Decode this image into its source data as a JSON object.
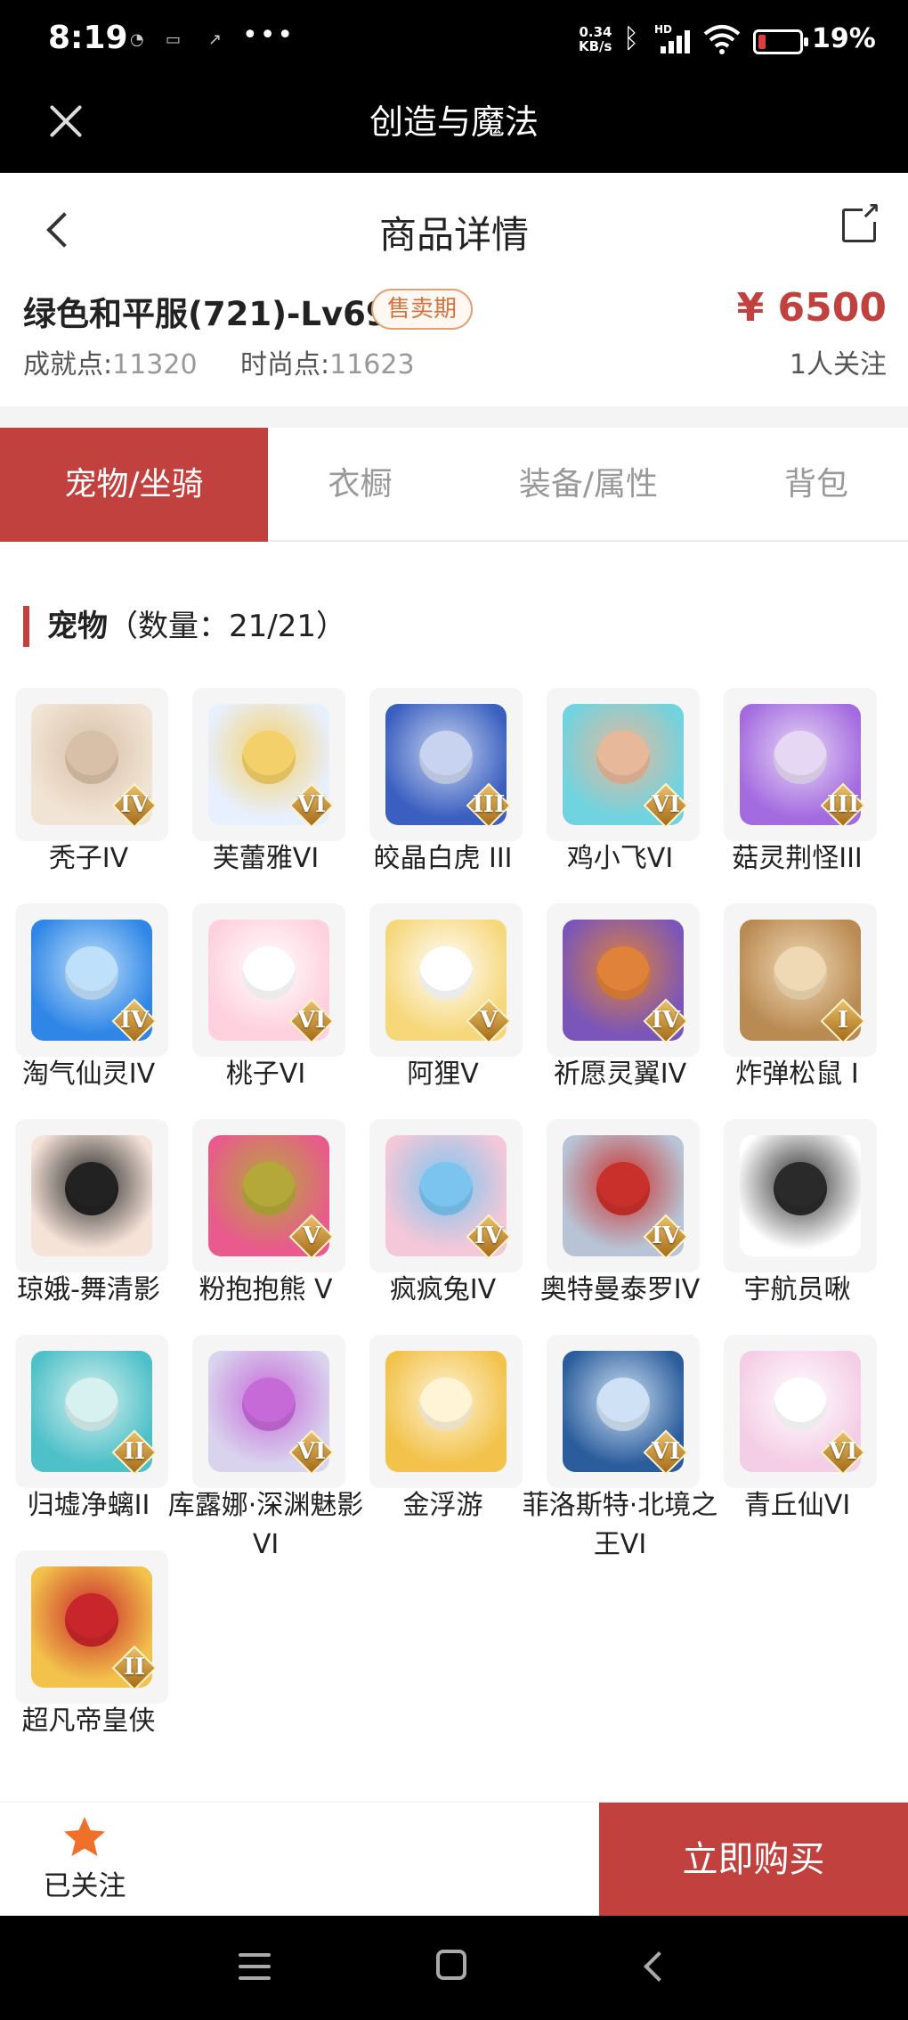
{
  "status_bar": {
    "time": "8:19",
    "net_speed_value": "0.34",
    "net_speed_unit": "KB/s",
    "signal_tag": "HD",
    "battery_pct": "19%",
    "battery_level": 0.19
  },
  "app_bar": {
    "title": "创造与魔法"
  },
  "page": {
    "title": "商品详情"
  },
  "product": {
    "name": "绿色和平服(721)-Lv69",
    "badge": "售卖期",
    "price": "¥ 6500",
    "achievement_label": "成就点:",
    "achievement_value": "11320",
    "fashion_label": "时尚点:",
    "fashion_value": "11623",
    "followers": "1人关注"
  },
  "tabs": [
    {
      "label": "宠物/坐骑",
      "active": true
    },
    {
      "label": "衣橱",
      "active": false
    },
    {
      "label": "装备/属性",
      "active": false
    },
    {
      "label": "背包",
      "active": false
    }
  ],
  "section": {
    "title": "宠物",
    "count_text": "（数量：21/21）"
  },
  "pets": [
    {
      "name": "秃子IV",
      "rank": "IV",
      "icon": "bald-kid-pet",
      "colors": [
        "#f1e4d4",
        "#d8c0a8"
      ]
    },
    {
      "name": "芙蕾雅VI",
      "rank": "VI",
      "icon": "winged-girl-pet",
      "colors": [
        "#e8f0ff",
        "#f4d06a"
      ]
    },
    {
      "name": "皎晶白虎 III",
      "rank": "III",
      "icon": "white-tiger-pet",
      "colors": [
        "#3a5fc0",
        "#c8d4ef"
      ]
    },
    {
      "name": "鸡小飞VI",
      "rank": "VI",
      "icon": "chick-pet",
      "colors": [
        "#6fd3e0",
        "#e8b89a"
      ]
    },
    {
      "name": "菇灵荆怪III",
      "rank": "III",
      "icon": "mushroom-elf-pet",
      "colors": [
        "#a46be0",
        "#e6d7f5"
      ]
    },
    {
      "name": "淘气仙灵IV",
      "rank": "IV",
      "icon": "blue-dog-pet",
      "colors": [
        "#2f86e6",
        "#bfe0fb"
      ]
    },
    {
      "name": "桃子VI",
      "rank": "VI",
      "icon": "pink-bunny-pet",
      "colors": [
        "#ffd0de",
        "#ffffff"
      ]
    },
    {
      "name": "阿狸V",
      "rank": "V",
      "icon": "lion-cat-pet",
      "colors": [
        "#f6d77a",
        "#ffffff"
      ]
    },
    {
      "name": "祈愿灵翼IV",
      "rank": "IV",
      "icon": "eagle-pet",
      "colors": [
        "#7b56b8",
        "#e0823a"
      ]
    },
    {
      "name": "炸弹松鼠 I",
      "rank": "I",
      "icon": "squirrel-pet",
      "colors": [
        "#b98a52",
        "#efd8b4"
      ]
    },
    {
      "name": "琼娥-舞清影",
      "rank": "",
      "icon": "dancer-girl-pet",
      "colors": [
        "#f5e3d8",
        "#222222"
      ]
    },
    {
      "name": "粉抱抱熊 V",
      "rank": "V",
      "icon": "pink-bear-pet",
      "colors": [
        "#e85b8c",
        "#b5a83a"
      ]
    },
    {
      "name": "疯疯兔IV",
      "rank": "IV",
      "icon": "crazy-rabbit-pet",
      "colors": [
        "#f4c8d8",
        "#7cc4f0"
      ]
    },
    {
      "name": "奥特曼泰罗IV",
      "rank": "IV",
      "icon": "ultraman-pet",
      "colors": [
        "#b8c4d6",
        "#c9302c"
      ]
    },
    {
      "name": "宇航员啾",
      "rank": "",
      "icon": "astronaut-pet",
      "colors": [
        "#ffffff",
        "#2a2a2a"
      ]
    },
    {
      "name": "归墟净螭II",
      "rank": "II",
      "icon": "teal-dragon-pet",
      "colors": [
        "#4ec0c8",
        "#d6f1ef"
      ]
    },
    {
      "name": "库露娜·深渊魅影VI",
      "rank": "VI",
      "icon": "abyss-girl-pet",
      "colors": [
        "#d9d3ee",
        "#c66ad8"
      ]
    },
    {
      "name": "金浮游",
      "rank": "",
      "icon": "golden-dragon-pet",
      "colors": [
        "#f2c24b",
        "#fff4d6"
      ]
    },
    {
      "name": "菲洛斯特·北境之王VI",
      "rank": "VI",
      "icon": "frost-king-pet",
      "colors": [
        "#2b5d9c",
        "#cfe1f4"
      ]
    },
    {
      "name": "青丘仙VI",
      "rank": "VI",
      "icon": "fox-fairy-pet",
      "colors": [
        "#f4cde6",
        "#ffffff"
      ]
    },
    {
      "name": "超凡帝皇侠",
      "rank": "II",
      "icon": "golden-armor-pet",
      "colors": [
        "#f2c24b",
        "#c8262a"
      ]
    }
  ],
  "bottom": {
    "follow_label": "已关注",
    "buy_label": "立即购买"
  },
  "colors": {
    "accent": "#c0413e",
    "badge_text": "#d4733b",
    "star": "#f0702a"
  }
}
